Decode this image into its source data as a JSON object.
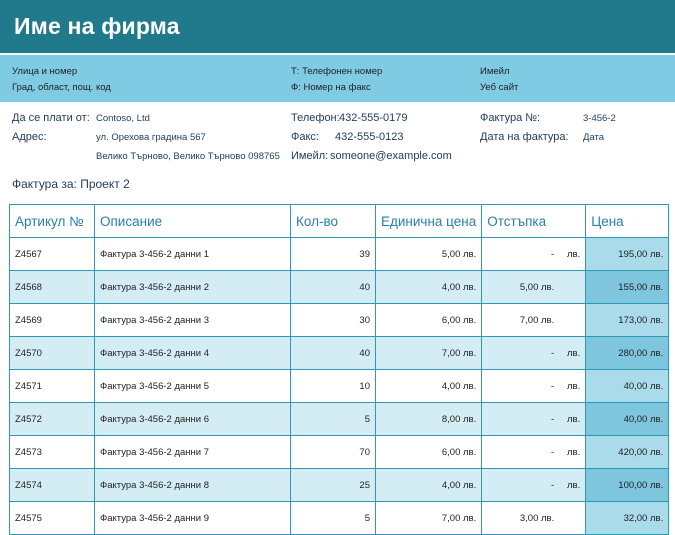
{
  "header": {
    "company_name": "Име на фирма"
  },
  "address_bar": {
    "street": "Улица и номер",
    "city": "Град, област, пощ. код",
    "phone": "Т: Телефонен номер",
    "fax": "Ф: Номер на факс",
    "email": "Имейл",
    "website": "Уеб сайт"
  },
  "pay_to": {
    "label": "Да се плати от:",
    "name": "Contoso, Ltd",
    "address_label": "Адрес:",
    "address_line1": "ул. Орехова градина 567",
    "address_line2": "Велико Търново, Велико Търново 098765"
  },
  "contact": {
    "phone_label": "Телефон:",
    "phone": "432-555-0179",
    "fax_label": "Факс:",
    "fax": "432-555-0123",
    "email_label": "Имейл:",
    "email": "someone@example.com"
  },
  "invoice": {
    "number_label": "Фактура №:",
    "number": "3-456-2",
    "date_label": "Дата на фактура:",
    "date": "Дата"
  },
  "bill_for": "Фактура за: Проект 2",
  "table": {
    "headers": [
      "Артикул №",
      "Описание",
      "Кол-во",
      "Единична цена",
      "Отстъпка",
      "Цена"
    ],
    "rows": [
      {
        "item": "Z4567",
        "desc": "Фактура 3-456-2 данни 1",
        "qty": "39",
        "unit": "5,00 лв.",
        "disc": "-",
        "disc_cur": "лв.",
        "price": "195,00 лв."
      },
      {
        "item": "Z4568",
        "desc": "Фактура 3-456-2 данни 2",
        "qty": "40",
        "unit": "4,00 лв.",
        "disc": "5,00 лв.",
        "disc_cur": "",
        "price": "155,00 лв."
      },
      {
        "item": "Z4569",
        "desc": "Фактура 3-456-2 данни 3",
        "qty": "30",
        "unit": "6,00 лв.",
        "disc": "7,00 лв.",
        "disc_cur": "",
        "price": "173,00 лв."
      },
      {
        "item": "Z4570",
        "desc": "Фактура 3-456-2 данни 4",
        "qty": "40",
        "unit": "7,00 лв.",
        "disc": "-",
        "disc_cur": "лв.",
        "price": "280,00 лв."
      },
      {
        "item": "Z4571",
        "desc": "Фактура 3-456-2 данни 5",
        "qty": "10",
        "unit": "4,00 лв.",
        "disc": "-",
        "disc_cur": "лв.",
        "price": "40,00 лв."
      },
      {
        "item": "Z4572",
        "desc": "Фактура 3-456-2 данни 6",
        "qty": "5",
        "unit": "8,00 лв.",
        "disc": "-",
        "disc_cur": "лв.",
        "price": "40,00 лв."
      },
      {
        "item": "Z4573",
        "desc": "Фактура 3-456-2 данни 7",
        "qty": "70",
        "unit": "6,00 лв.",
        "disc": "-",
        "disc_cur": "лв.",
        "price": "420,00 лв."
      },
      {
        "item": "Z4574",
        "desc": "Фактура 3-456-2 данни 8",
        "qty": "25",
        "unit": "4,00 лв.",
        "disc": "-",
        "disc_cur": "лв.",
        "price": "100,00 лв."
      },
      {
        "item": "Z4575",
        "desc": "Фактура 3-456-2 данни 9",
        "qty": "5",
        "unit": "7,00 лв.",
        "disc": "3,00 лв.",
        "disc_cur": "",
        "price": "32,00 лв."
      }
    ]
  }
}
